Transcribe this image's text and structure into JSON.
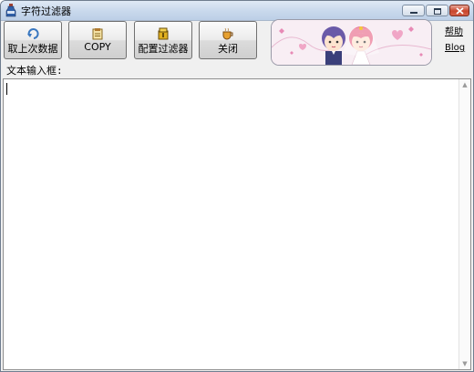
{
  "window": {
    "title": "字符过滤器",
    "icon": "app-bottle-icon"
  },
  "toolbar": {
    "buttons": [
      {
        "label": "取上次数据",
        "icon": "refresh-arrow-icon"
      },
      {
        "label": "COPY",
        "icon": "clipboard-icon"
      },
      {
        "label": "配置过滤器",
        "icon": "gold-box-icon"
      },
      {
        "label": "关闭",
        "icon": "coffee-cup-icon"
      }
    ]
  },
  "links": {
    "help": "帮助",
    "blog": "Blog"
  },
  "editor": {
    "label": "文本输入框:",
    "value": ""
  },
  "colors": {
    "title_bar": "#c8d8ec",
    "close_button": "#c8452c",
    "window_bg": "#f0f0f0"
  }
}
